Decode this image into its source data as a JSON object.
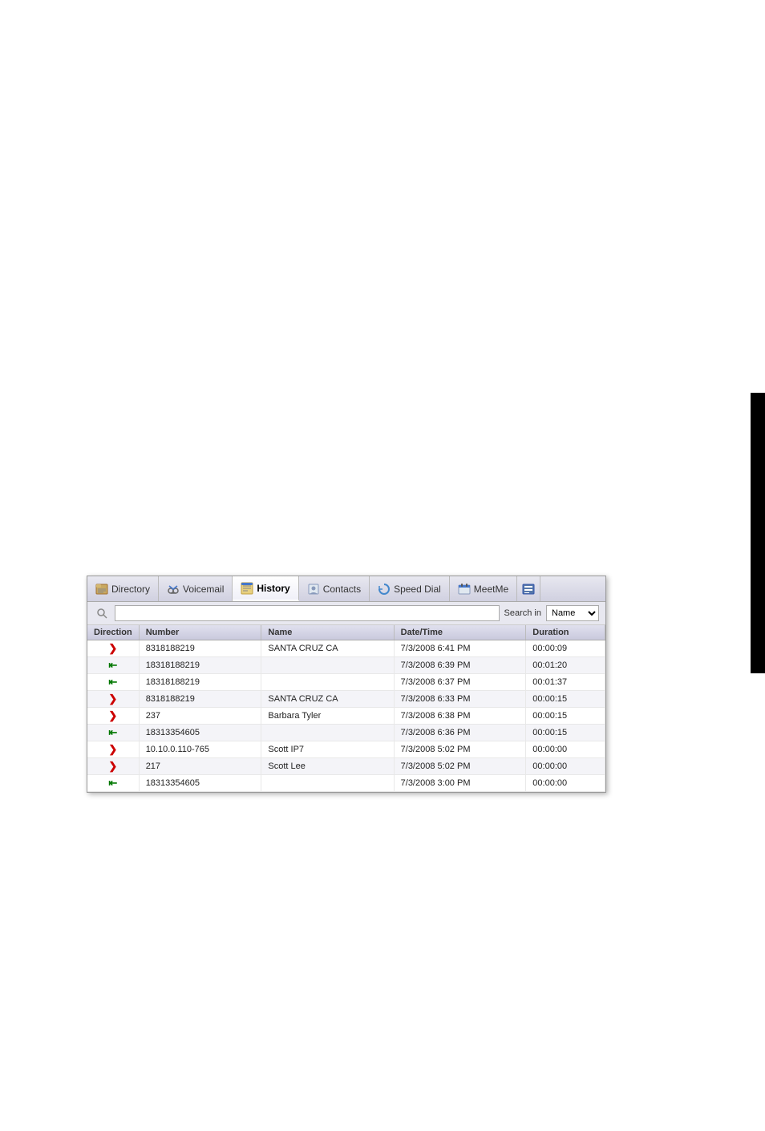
{
  "tabs": [
    {
      "id": "directory",
      "label": "Directory",
      "icon": "📋",
      "active": false
    },
    {
      "id": "voicemail",
      "label": "Voicemail",
      "icon": "📞",
      "active": false
    },
    {
      "id": "history",
      "label": "History",
      "icon": "🕐",
      "active": true
    },
    {
      "id": "contacts",
      "label": "Contacts",
      "icon": "👤",
      "active": false
    },
    {
      "id": "speeddial",
      "label": "Speed Dial",
      "icon": "🔄",
      "active": false
    },
    {
      "id": "meetme",
      "label": "MeetMe",
      "icon": "📅",
      "active": false
    }
  ],
  "search": {
    "placeholder": "",
    "search_in_label": "Search in",
    "search_in_value": "Name"
  },
  "table": {
    "columns": [
      {
        "id": "direction",
        "label": "Direction"
      },
      {
        "id": "number",
        "label": "Number"
      },
      {
        "id": "name",
        "label": "Name"
      },
      {
        "id": "datetime",
        "label": "Date/Time"
      },
      {
        "id": "duration",
        "label": "Duration"
      }
    ],
    "rows": [
      {
        "direction": "out",
        "number": "8318188219",
        "name": "SANTA CRUZ  CA",
        "datetime": "7/3/2008 6:41 PM",
        "duration": "00:00:09"
      },
      {
        "direction": "in",
        "number": "18318188219",
        "name": "",
        "datetime": "7/3/2008 6:39 PM",
        "duration": "00:01:20"
      },
      {
        "direction": "in-missed",
        "number": "18318188219",
        "name": "",
        "datetime": "7/3/2008 6:37 PM",
        "duration": "00:01:37"
      },
      {
        "direction": "out",
        "number": "8318188219",
        "name": "SANTA CRUZ  CA",
        "datetime": "7/3/2008 6:33 PM",
        "duration": "00:00:15"
      },
      {
        "direction": "out",
        "number": "237",
        "name": "Barbara Tyler",
        "datetime": "7/3/2008 6:38 PM",
        "duration": "00:00:15"
      },
      {
        "direction": "in",
        "number": "18313354605",
        "name": "",
        "datetime": "7/3/2008 6:36 PM",
        "duration": "00:00:15"
      },
      {
        "direction": "out",
        "number": "10.10.0.110-765",
        "name": "Scott IP7",
        "datetime": "7/3/2008 5:02 PM",
        "duration": "00:00:00"
      },
      {
        "direction": "out",
        "number": "217",
        "name": "Scott Lee",
        "datetime": "7/3/2008 5:02 PM",
        "duration": "00:00:00"
      },
      {
        "direction": "in",
        "number": "18313354605",
        "name": "",
        "datetime": "7/3/2008 3:00 PM",
        "duration": "00:00:00"
      }
    ]
  }
}
